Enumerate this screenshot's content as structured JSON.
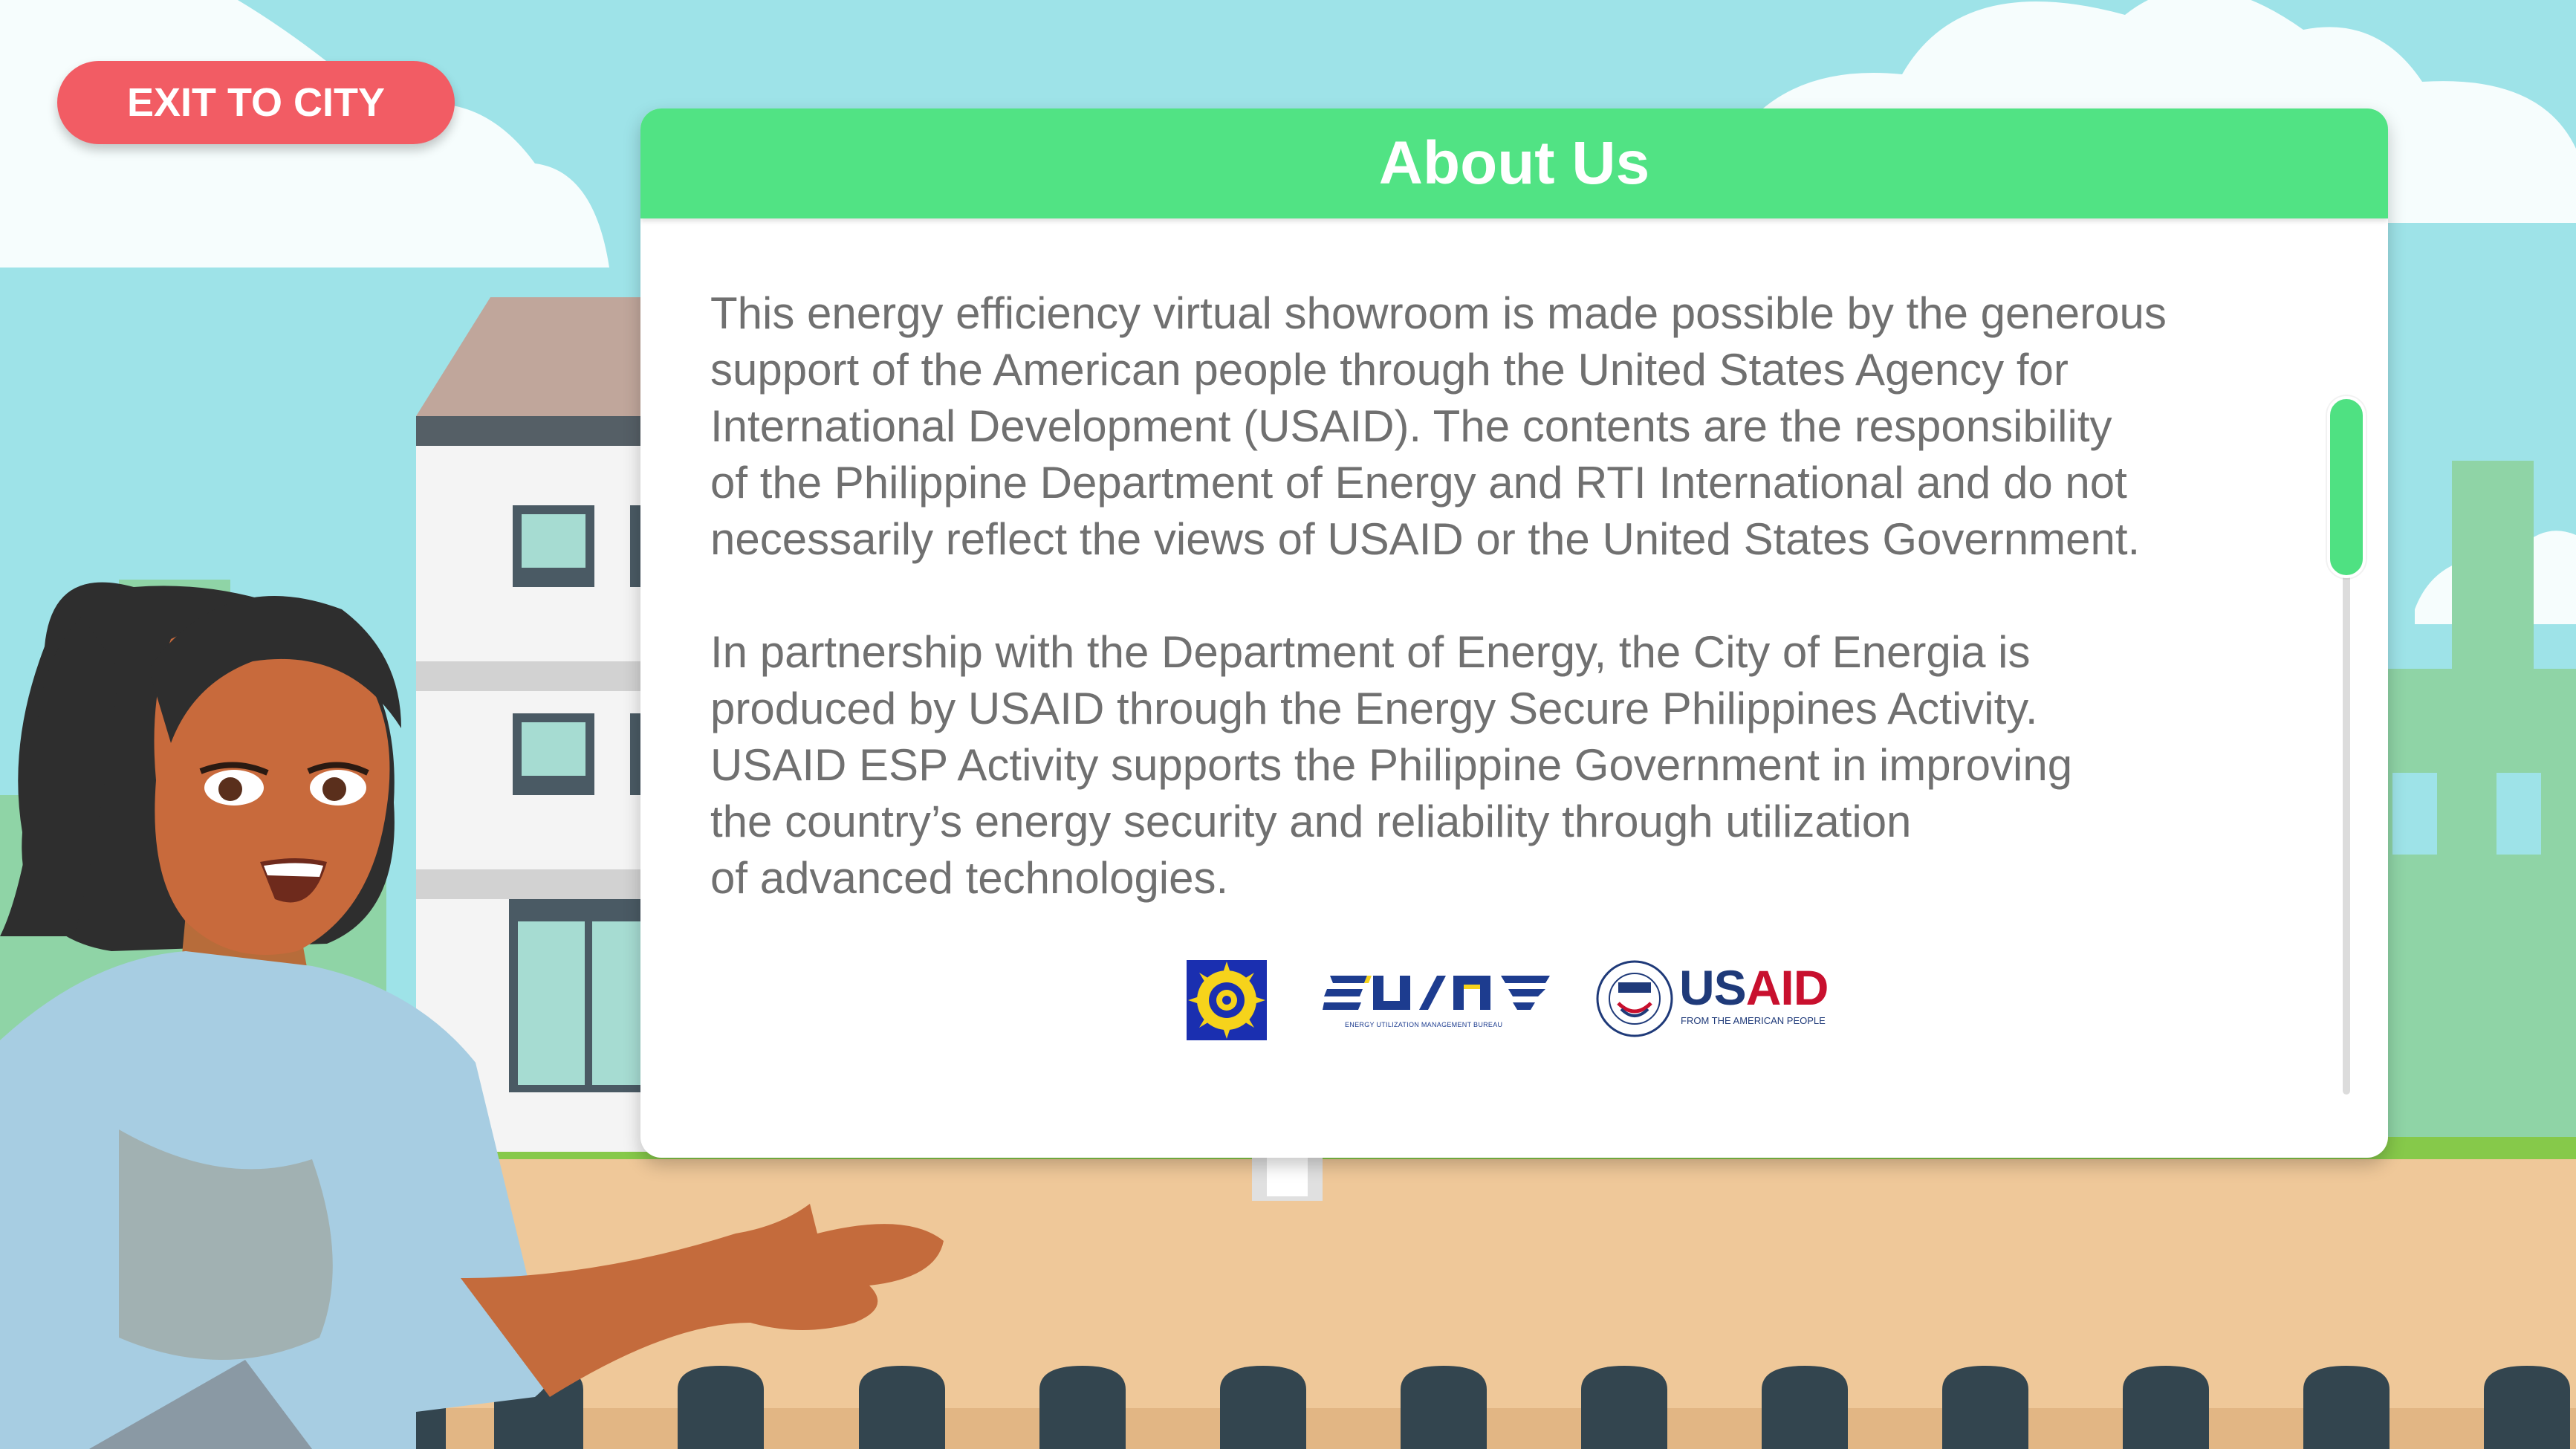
{
  "exit_button": {
    "label": "EXIT TO CITY"
  },
  "modal": {
    "title": "About Us",
    "paragraphs": [
      "This energy efficiency virtual showroom is made possible by the generous\nsupport of the American people through the United States Agency for\nInternational Development (USAID). The contents are the responsibility\nof the Philippine Department of Energy and RTI International and do not\nnecessarily reflect the views of USAID or the United States Government.",
      "In partnership with the Department of Energy, the City of Energia is\nproduced by USAID through the Energy Secure Philippines Activity.\nUSAID ESP Activity supports the Philippine Government in improving\nthe country’s energy security and reliability through utilization\nof advanced technologies."
    ],
    "scroll_position": 0.0
  },
  "logos": {
    "doe": {
      "icon": "doe-seal-icon"
    },
    "eumb": {
      "text": "EUMB",
      "subtitle": "ENERGY UTILIZATION MANAGEMENT BUREAU"
    },
    "usaid": {
      "us": "US",
      "aid": "AID",
      "subtitle": "FROM THE AMERICAN PEOPLE",
      "seal_text": "USAID"
    }
  },
  "colors": {
    "accent_green": "#51e384",
    "exit_red": "#f25c64",
    "sky": "#9ee3e8",
    "body_text": "#707070",
    "usaid_blue": "#1f3a79",
    "usaid_red": "#c8102e"
  }
}
